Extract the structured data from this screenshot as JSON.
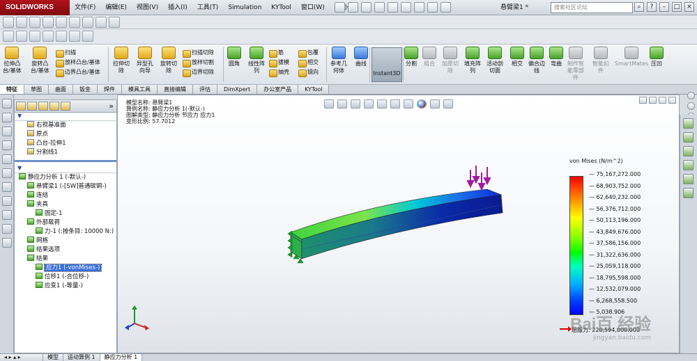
{
  "app": {
    "brand": "SOLIDWORKS",
    "document_title": "悬臂梁1 *"
  },
  "menu": [
    "文件(F)",
    "编辑(E)",
    "视图(V)",
    "插入(I)",
    "工具(T)",
    "Simulation",
    "KYTool",
    "窗口(W)",
    "帮助(H)"
  ],
  "search": {
    "placeholder": "搜索社区论坛"
  },
  "ribbon": {
    "big": [
      {
        "label": "拉伸凸\n台/基体",
        "style": "yellow"
      },
      {
        "label": "旋转凸\n台/基体",
        "style": "yellow"
      },
      {
        "label": "拉伸切\n除",
        "style": "yellow"
      },
      {
        "label": "异型孔\n向导",
        "style": "yellow"
      },
      {
        "label": "旋转切\n除",
        "style": "yellow"
      },
      {
        "label": "圆角",
        "style": "green"
      },
      {
        "label": "线性阵\n列",
        "style": "green"
      },
      {
        "label": "参考几\n何体",
        "style": "blue"
      },
      {
        "label": "曲线",
        "style": "blue"
      },
      {
        "label": "分割",
        "style": "green"
      },
      {
        "label": "组合",
        "style": "gray"
      },
      {
        "label": "加厚切\n除",
        "style": "gray"
      },
      {
        "label": "填充阵\n列",
        "style": "green"
      },
      {
        "label": "活动剖\n切面",
        "style": "green"
      },
      {
        "label": "相交",
        "style": "green"
      },
      {
        "label": "偏合边\n线",
        "style": "green"
      },
      {
        "label": "弯曲",
        "style": "green"
      },
      {
        "label": "制作智\n能零部\n件",
        "style": "gray"
      },
      {
        "label": "智能扣\n件",
        "style": "gray"
      },
      {
        "label": "SmartMates",
        "style": "gray"
      },
      {
        "label": "压凹",
        "style": "green"
      }
    ],
    "small": [
      {
        "label": "扫描"
      },
      {
        "label": "放样凸台/基体"
      },
      {
        "label": "边界凸台/基体"
      },
      {
        "label": "扫描切除"
      },
      {
        "label": "放样切割"
      },
      {
        "label": "边界切除"
      },
      {
        "label": "筋"
      },
      {
        "label": "拔模"
      },
      {
        "label": "抽壳"
      },
      {
        "label": "包覆"
      },
      {
        "label": "相交"
      },
      {
        "label": "镜向"
      }
    ],
    "instant3d": "Instant3D"
  },
  "tabs": [
    "特征",
    "草图",
    "曲面",
    "钣金",
    "焊件",
    "模具工具",
    "直接编辑",
    "评估",
    "DimXpert",
    "办公室产品",
    "KYTool"
  ],
  "active_tab": "特征",
  "feature_tree_top": [
    {
      "label": "右视基准面",
      "indent": 1
    },
    {
      "label": "原点",
      "indent": 1
    },
    {
      "label": "凸台-拉伸1",
      "indent": 1
    },
    {
      "label": "分割线1",
      "indent": 1
    }
  ],
  "study_tree": [
    {
      "label": "静应力分析 1 (-默认-)",
      "indent": 0
    },
    {
      "label": "悬臂梁1 (-[SW]普通碳钢-)",
      "indent": 1
    },
    {
      "label": "连结",
      "indent": 1
    },
    {
      "label": "夹具",
      "indent": 1
    },
    {
      "label": "固定-1",
      "indent": 2
    },
    {
      "label": "外部载荷",
      "indent": 1
    },
    {
      "label": "力-1 (:按条目: 10000 N:)",
      "indent": 2
    },
    {
      "label": "网格",
      "indent": 1
    },
    {
      "label": "结果选项",
      "indent": 1
    },
    {
      "label": "结果",
      "indent": 1
    },
    {
      "label": "应力1 (-vonMises-)",
      "indent": 2,
      "selected": true
    },
    {
      "label": "位移1 (-合位移-)",
      "indent": 2
    },
    {
      "label": "应变1 (-等量-)",
      "indent": 2
    }
  ],
  "model_info": {
    "line1": "模型名称: 悬臂梁1",
    "line2": "算例名称: 静应力分析 1(-默认-)",
    "line3": "图解类型: 静应力分析 节应力 应力1",
    "line4": "变形比例: 57.7012"
  },
  "legend": {
    "title": "von Mises (N/m^2)",
    "values": [
      "75,167,272.000",
      "68,903,752.000",
      "62,640,232.000",
      "56,376,712.000",
      "50,113,196.000",
      "43,849,676.000",
      "37,586,156.000",
      "31,322,636.000",
      "25,059,118.000",
      "18,795,598.000",
      "12,532,079.000",
      "6,268,558.500",
      "5,038.906"
    ],
    "yield_label": "屈服力: 220,594,000.000"
  },
  "status_tabs": [
    "模型",
    "运动算例 1",
    "静应力分析 1"
  ],
  "active_status_tab": "静应力分析 1",
  "watermark": {
    "big": "Bai百 经验",
    "small": "jingyan.baidu.com"
  }
}
